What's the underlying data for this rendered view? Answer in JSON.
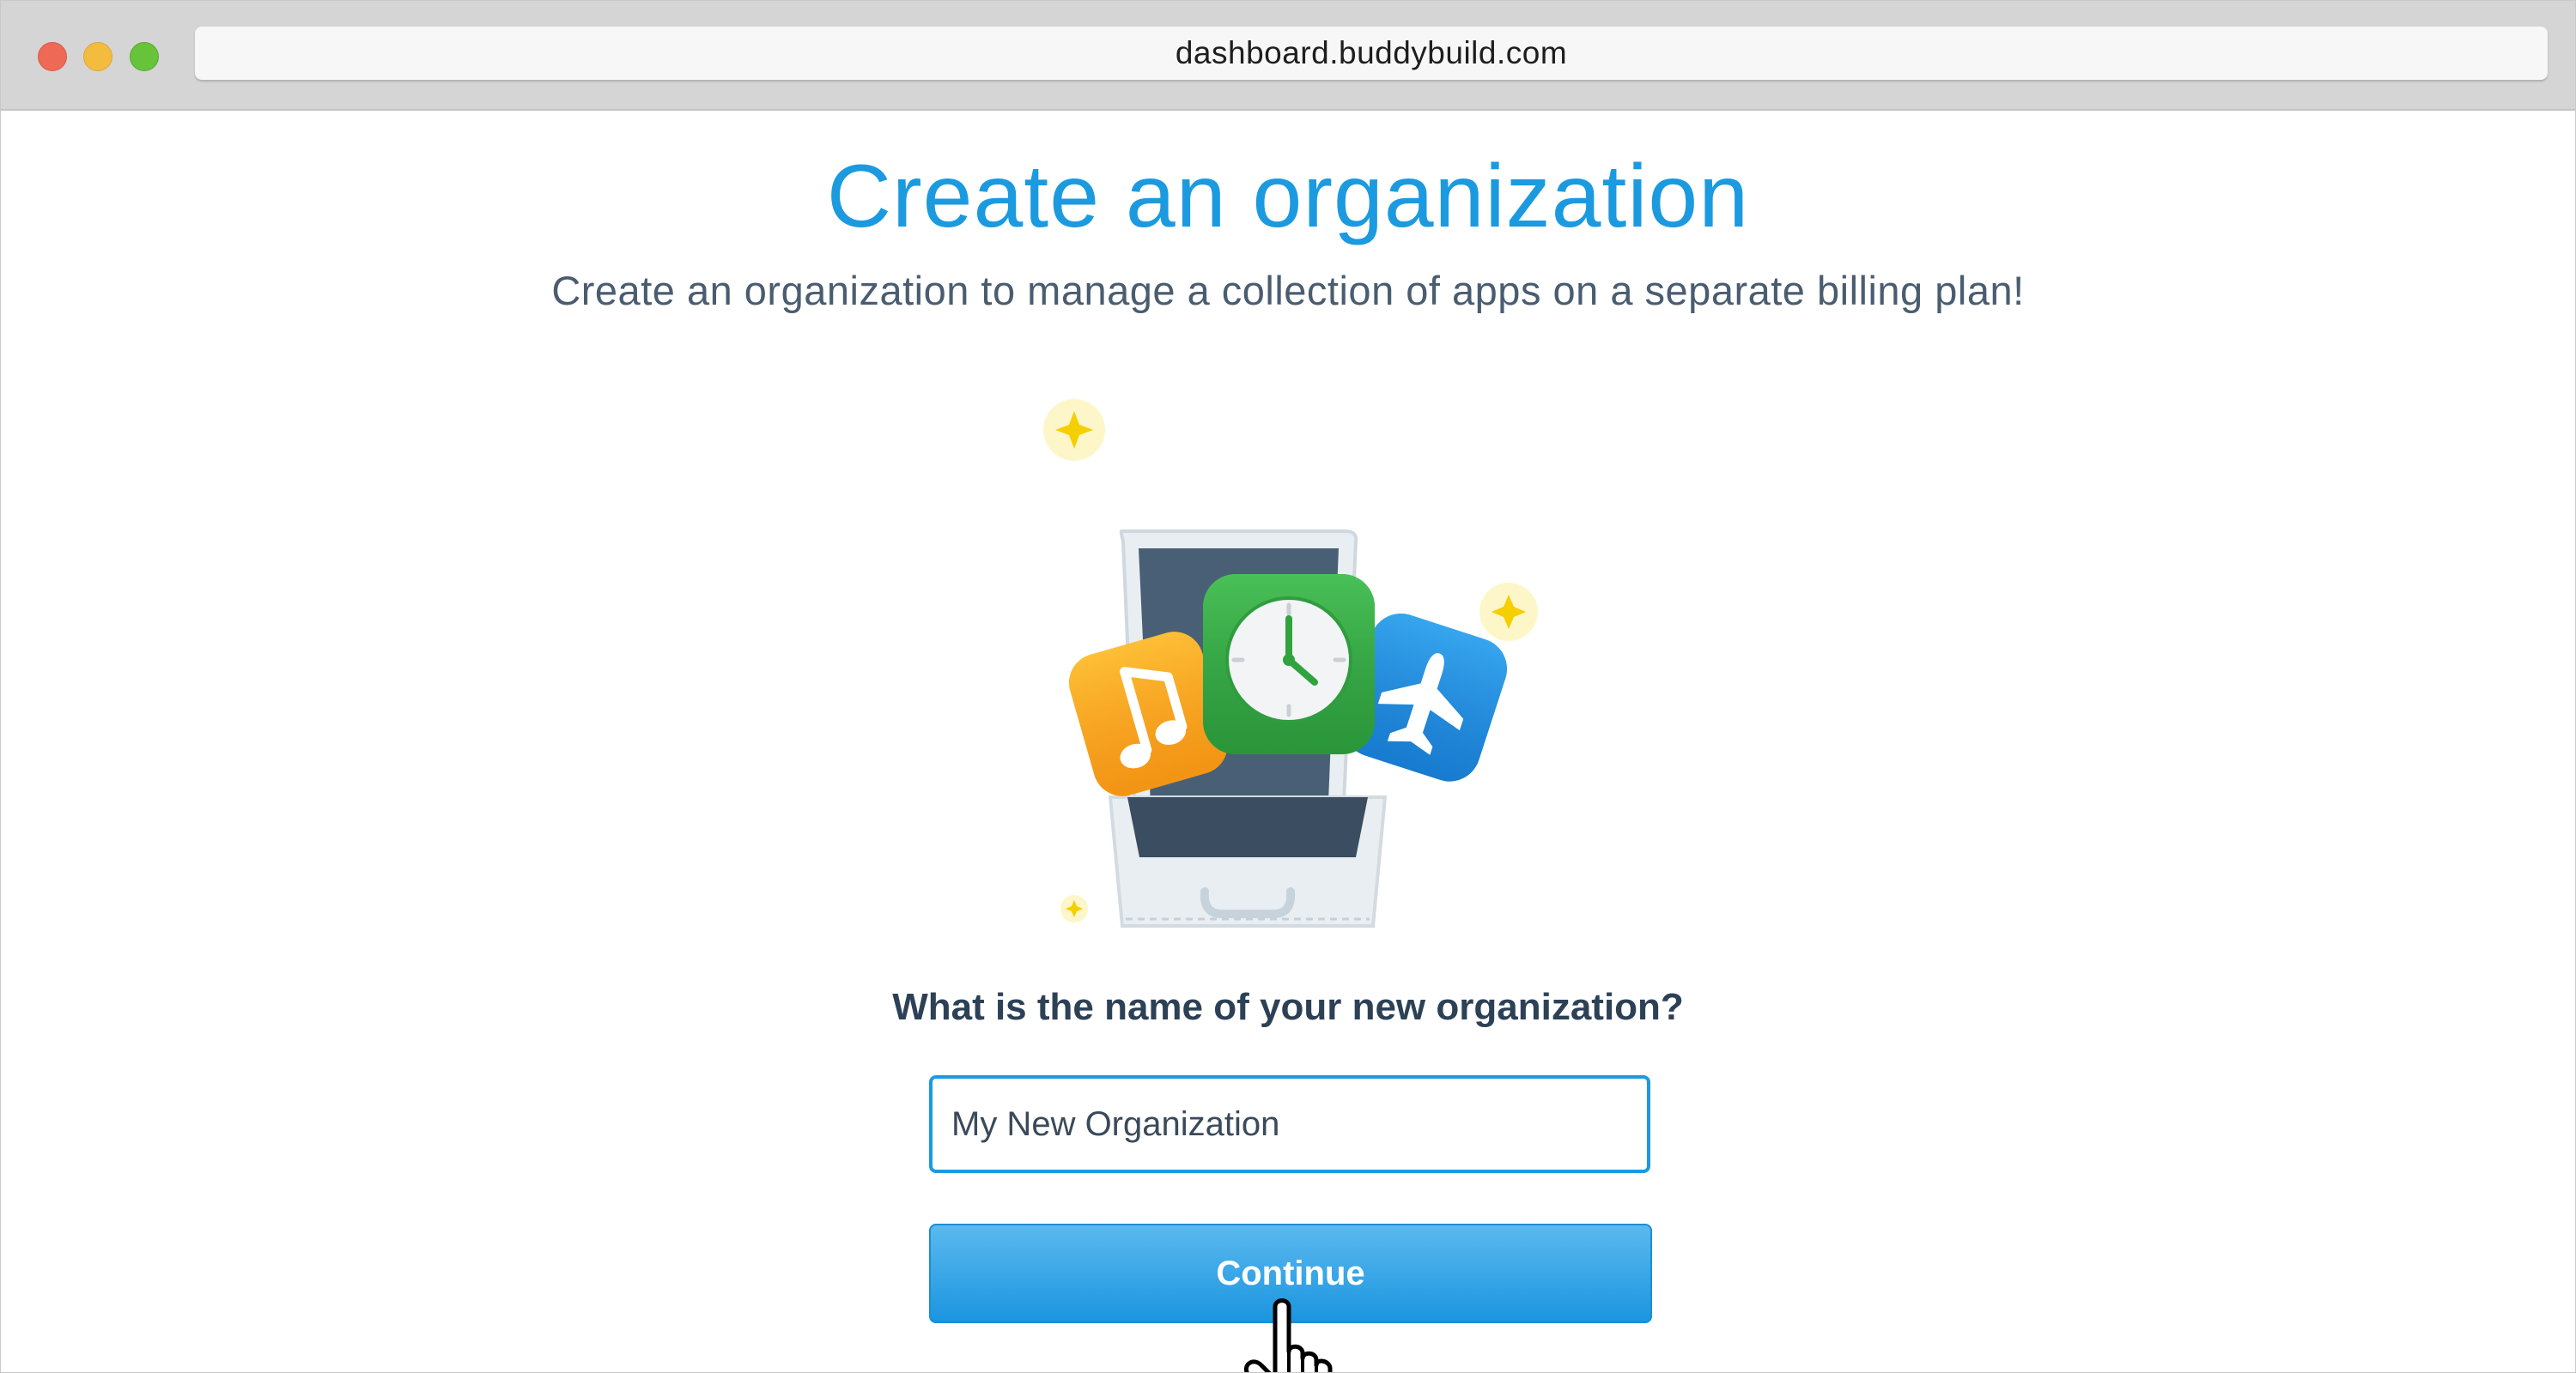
{
  "browser": {
    "url": "dashboard.buddybuild.com"
  },
  "page": {
    "title": "Create an organization",
    "subtitle": "Create an organization to manage a collection of apps on a separate billing plan!",
    "question": "What is the name of your new organization?"
  },
  "form": {
    "org_name_value": "My New Organization",
    "continue_label": "Continue"
  },
  "colors": {
    "accent": "#1b9ae0",
    "heading_text": "#2d4156",
    "subtitle_text": "#4a5d70",
    "music_icon": "#f7a51b",
    "clock_icon": "#3db54a",
    "plane_icon": "#1b8fe0",
    "sparkle": "#f5d800"
  },
  "icons": {
    "illustration": "briefcase-with-apps-illustration",
    "music": "music-note-icon",
    "clock": "clock-icon",
    "plane": "airplane-icon",
    "cursor": "hand-pointer-cursor"
  }
}
